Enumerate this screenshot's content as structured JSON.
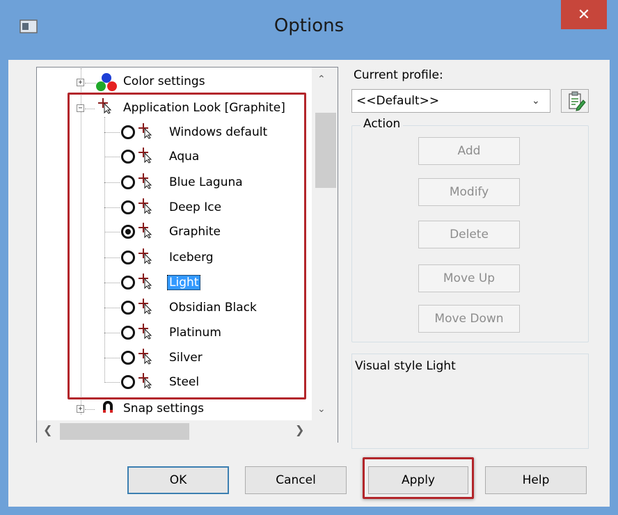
{
  "window": {
    "title": "Options",
    "close_glyph": "✕",
    "colors": {
      "title_bar": "#6ea1d8",
      "close_button": "#c7463b",
      "highlight_border": "#b3262b",
      "selection": "#3399ff"
    }
  },
  "tree": {
    "items": [
      {
        "label": "Color settings",
        "icon": "color-settings-icon",
        "expanded": false
      },
      {
        "label": "Application Look [Graphite]",
        "icon": "cursor-crosshair-icon",
        "expanded": true
      },
      {
        "label": "Windows default",
        "checked": false
      },
      {
        "label": "Aqua",
        "checked": false
      },
      {
        "label": "Blue Laguna",
        "checked": false
      },
      {
        "label": "Deep Ice",
        "checked": false
      },
      {
        "label": "Graphite",
        "checked": true
      },
      {
        "label": "Iceberg",
        "checked": false
      },
      {
        "label": "Light",
        "checked": false,
        "selected": true
      },
      {
        "label": "Obsidian Black",
        "checked": false
      },
      {
        "label": "Platinum",
        "checked": false
      },
      {
        "label": "Silver",
        "checked": false
      },
      {
        "label": "Steel",
        "checked": false
      },
      {
        "label": "Snap settings",
        "icon": "magnet-icon",
        "expanded": false
      }
    ]
  },
  "profile": {
    "label": "Current profile:",
    "value": "<<Default>>"
  },
  "action": {
    "group_label": "Action",
    "buttons": {
      "add": "Add",
      "modify": "Modify",
      "delete": "Delete",
      "move_up": "Move Up",
      "move_down": "Move Down"
    }
  },
  "description": "Visual style Light",
  "dialog_buttons": {
    "ok": "OK",
    "cancel": "Cancel",
    "apply": "Apply",
    "help": "Help"
  },
  "scroll_glyphs": {
    "up": "⌃",
    "down": "⌄",
    "left": "❮",
    "right": "❯",
    "combo_down": "⌄"
  }
}
